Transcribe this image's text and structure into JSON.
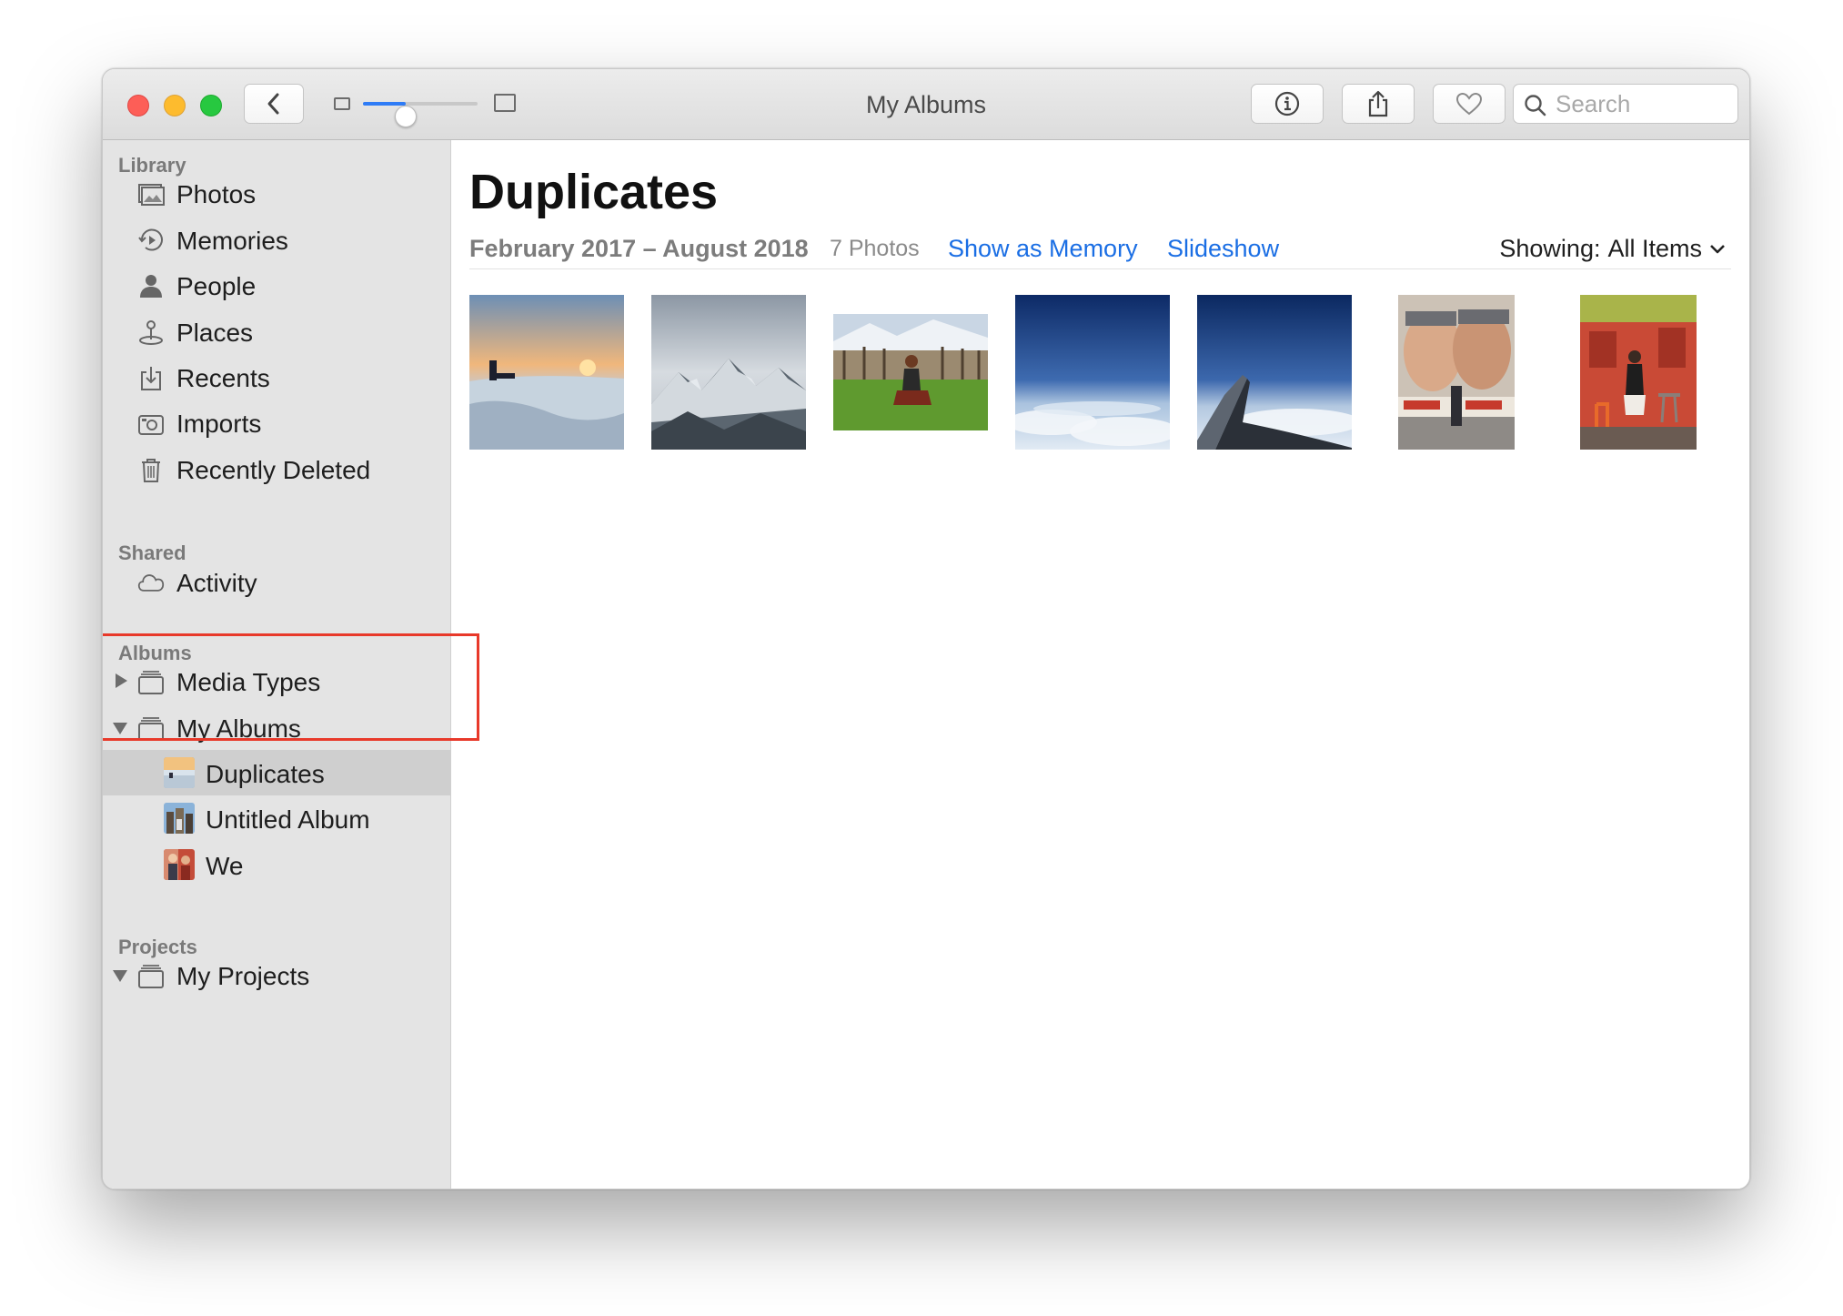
{
  "window": {
    "title": "My Albums"
  },
  "toolbar": {
    "icons": [
      "back-chevron-icon",
      "info-icon",
      "share-icon",
      "heart-icon",
      "rotate-icon",
      "search-icon"
    ],
    "zoom_slider_value": 0.37,
    "search_placeholder": "Search"
  },
  "sidebar": {
    "library_header": "Library",
    "library": [
      {
        "label": "Photos",
        "icon": "photos-icon"
      },
      {
        "label": "Memories",
        "icon": "memories-icon"
      },
      {
        "label": "People",
        "icon": "people-icon"
      },
      {
        "label": "Places",
        "icon": "places-icon"
      },
      {
        "label": "Recents",
        "icon": "recents-icon"
      },
      {
        "label": "Imports",
        "icon": "imports-icon"
      },
      {
        "label": "Recently Deleted",
        "icon": "trash-icon"
      }
    ],
    "shared_header": "Shared",
    "shared": [
      {
        "label": "Activity",
        "icon": "cloud-icon"
      }
    ],
    "albums_header": "Albums",
    "albums": [
      {
        "label": "Media Types",
        "icon": "folder-icon",
        "expanded": false
      },
      {
        "label": "My Albums",
        "icon": "folder-icon",
        "expanded": true
      }
    ],
    "my_albums": [
      {
        "label": "Duplicates",
        "selected": true
      },
      {
        "label": "Untitled Album",
        "selected": false
      },
      {
        "label": "We",
        "selected": false
      }
    ],
    "projects_header": "Projects",
    "projects": [
      {
        "label": "My Projects",
        "icon": "folder-icon",
        "expanded": true
      }
    ]
  },
  "main": {
    "album_title": "Duplicates",
    "date_range": "February 2017 – August 2018",
    "photo_count": "7 Photos",
    "show_as_memory": "Show as Memory",
    "slideshow": "Slideshow",
    "showing_label": "Showing:",
    "showing_value": "All Items",
    "photos": [
      {
        "name": "sunset-ice-beach"
      },
      {
        "name": "snowy-mountains"
      },
      {
        "name": "woman-sitting-vineyard"
      },
      {
        "name": "sky-above-clouds"
      },
      {
        "name": "airplane-wing-clouds"
      },
      {
        "name": "berlin-wall-kiss-mural"
      },
      {
        "name": "woman-red-cafe"
      }
    ]
  },
  "colors": {
    "accent": "#1a6ee4",
    "highlight_box": "#e8392a",
    "sidebar_bg": "#e4e4e4",
    "selected_row": "#cfcfcf"
  }
}
